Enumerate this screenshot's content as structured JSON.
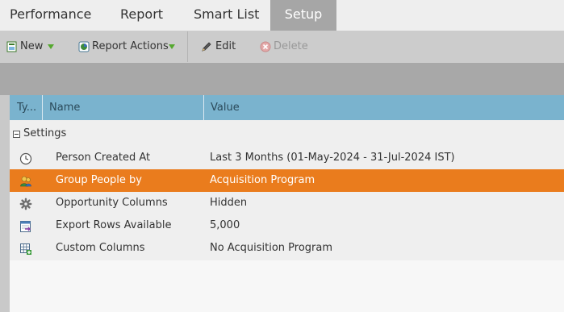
{
  "tabs": [
    {
      "label": "Performance",
      "active": false
    },
    {
      "label": "Report",
      "active": false
    },
    {
      "label": "Smart List",
      "active": false
    },
    {
      "label": "Setup",
      "active": true
    }
  ],
  "toolbar": {
    "new_label": "New",
    "report_actions_label": "Report Actions",
    "edit_label": "Edit",
    "delete_label": "Delete"
  },
  "grid": {
    "columns": {
      "type": "Ty...",
      "name": "Name",
      "value": "Value"
    },
    "group_label": "Settings",
    "rows": [
      {
        "icon": "clock-icon",
        "name": "Person Created At",
        "value": "Last 3 Months (01-May-2024 - 31-Jul-2024 IST)",
        "selected": false
      },
      {
        "icon": "people-group-icon",
        "name": "Group People by",
        "value": "Acquisition Program",
        "selected": true
      },
      {
        "icon": "gear-icon",
        "name": "Opportunity Columns",
        "value": "Hidden",
        "selected": false
      },
      {
        "icon": "export-rows-icon",
        "name": "Export Rows Available",
        "value": "5,000",
        "selected": false
      },
      {
        "icon": "custom-columns-icon",
        "name": "Custom Columns",
        "value": "No Acquisition Program",
        "selected": false
      }
    ]
  },
  "colors": {
    "selected_row": "#ea7c1d",
    "header": "#7ab3ce",
    "active_tab": "#a6a6a6"
  }
}
